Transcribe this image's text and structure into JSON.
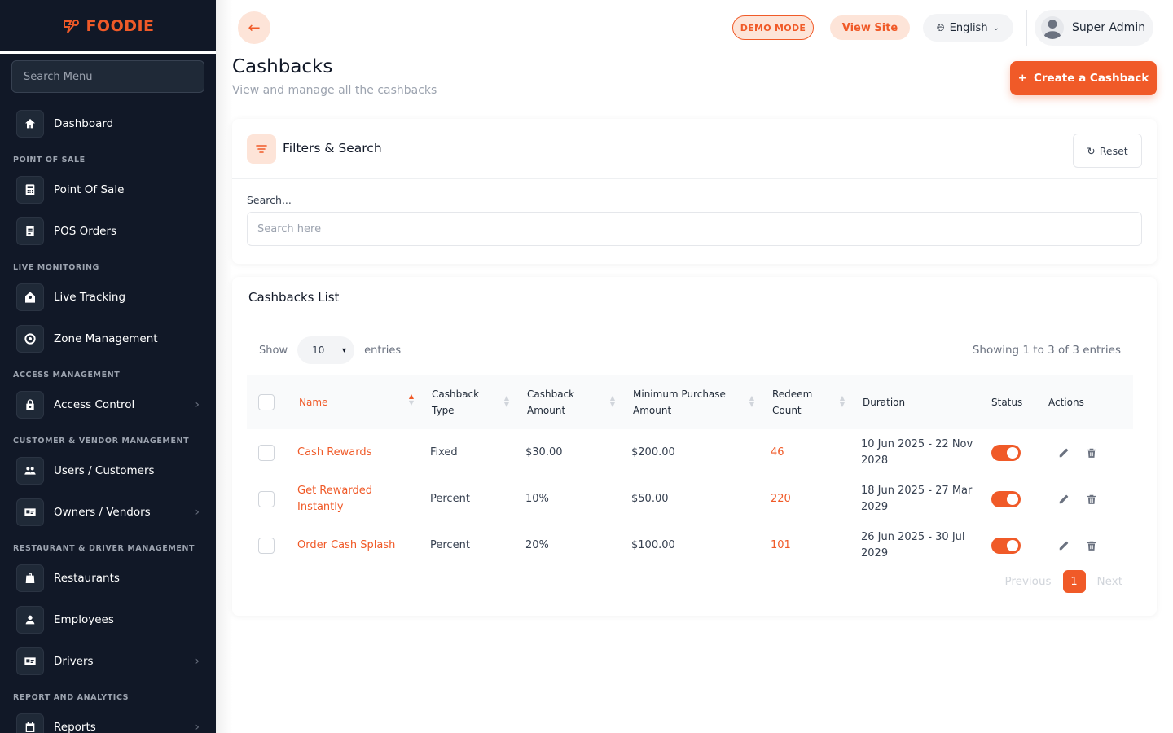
{
  "brand": {
    "name": "FOODIE",
    "accent": "#f05a28"
  },
  "sidebar": {
    "search_placeholder": "Search Menu",
    "dashboard": "Dashboard",
    "sections": {
      "pos": "POINT OF SALE",
      "live": "LIVE MONITORING",
      "access": "ACCESS MANAGEMENT",
      "customer": "CUSTOMER & VENDOR MANAGEMENT",
      "restaurant": "RESTAURANT & DRIVER MANAGEMENT",
      "report": "REPORT AND ANALYTICS"
    },
    "items": {
      "point_of_sale": "Point Of Sale",
      "pos_orders": "POS Orders",
      "live_tracking": "Live Tracking",
      "zone_management": "Zone Management",
      "access_control": "Access Control",
      "users_customers": "Users / Customers",
      "owners_vendors": "Owners / Vendors",
      "restaurants": "Restaurants",
      "employees": "Employees",
      "drivers": "Drivers",
      "reports": "Reports"
    }
  },
  "header": {
    "demo_mode": "DEMO MODE",
    "view_site": "View Site",
    "language": "English",
    "user": "Super Admin"
  },
  "page": {
    "title": "Cashbacks",
    "subtitle": "View and manage all the cashbacks",
    "create_button": "Create a Cashback"
  },
  "filters": {
    "title": "Filters & Search",
    "reset": "Reset",
    "search_label": "Search...",
    "search_placeholder": "Search here"
  },
  "list": {
    "title": "Cashbacks List",
    "show": "Show",
    "page_size": "10",
    "entries": "entries",
    "showing": "Showing 1 to 3 of 3 entries",
    "columns": {
      "name": "Name",
      "type": "Cashback Type",
      "amount": "Cashback Amount",
      "min_purchase": "Minimum Purchase Amount",
      "redeem": "Redeem Count",
      "duration": "Duration",
      "status": "Status",
      "actions": "Actions"
    },
    "rows": [
      {
        "name": "Cash Rewards",
        "type": "Fixed",
        "amount": "$30.00",
        "min_purchase": "$200.00",
        "redeem": "46",
        "duration": "10 Jun 2025 - 22 Nov 2028",
        "status": true
      },
      {
        "name": "Get Rewarded Instantly",
        "type": "Percent",
        "amount": "10%",
        "min_purchase": "$50.00",
        "redeem": "220",
        "duration": "18 Jun 2025 - 27 Mar 2029",
        "status": true
      },
      {
        "name": "Order Cash Splash",
        "type": "Percent",
        "amount": "20%",
        "min_purchase": "$100.00",
        "redeem": "101",
        "duration": "26 Jun 2025 - 30 Jul 2029",
        "status": true
      }
    ],
    "pagination": {
      "previous": "Previous",
      "current": "1",
      "next": "Next"
    }
  }
}
